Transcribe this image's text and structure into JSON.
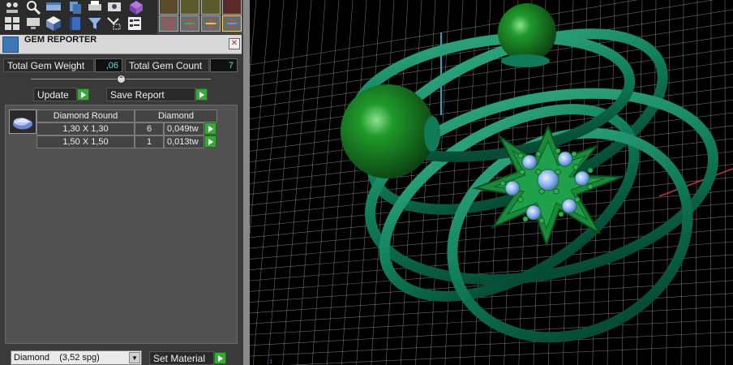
{
  "panel": {
    "title": "GEM REPORTER",
    "close_glyph": "✕"
  },
  "totals": {
    "weight_label": "Total Gem Weight",
    "weight_value": ",06",
    "count_label": "Total Gem Count",
    "count_value": "7"
  },
  "actions": {
    "update_label": "Update",
    "save_report_label": "Save Report"
  },
  "report": {
    "columns": [
      "Diamond Round",
      "Diamond"
    ],
    "rows": [
      {
        "size": "1,30 X 1,30",
        "count": "6",
        "weight": "0,049tw"
      },
      {
        "size": "1,50 X 1,50",
        "count": "1",
        "weight": "0,013tw"
      }
    ]
  },
  "material": {
    "selected": "Diamond    (3,52 spg)",
    "set_label": "Set Material"
  },
  "colors": {
    "ring": "#0f7a58",
    "sphere": "#1e8a2a",
    "gem": "#8ab4f0",
    "grid": "#bfbfbf",
    "accent_go": "#39a83b"
  },
  "icons": [
    "cursor-icon",
    "zoom-icon",
    "view-icon",
    "copy-icon",
    "print-icon",
    "camera-icon",
    "gem-cube-icon",
    "layout-icon",
    "monitor-icon",
    "cube-icon",
    "book-icon",
    "filter-icon",
    "select-icon",
    "list-icon",
    "move-icon",
    "scale-icon",
    "rotate-icon",
    "transform-icon"
  ]
}
